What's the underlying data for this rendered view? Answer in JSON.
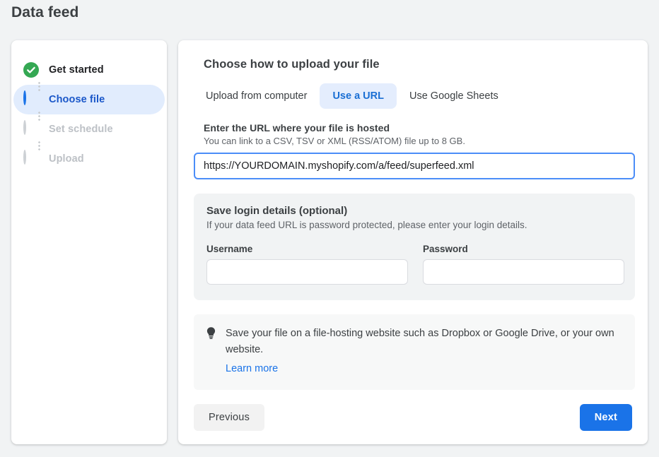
{
  "page": {
    "title": "Data feed",
    "background_color": "#f1f3f4"
  },
  "stepper": {
    "steps": [
      {
        "label": "Get started",
        "state": "done",
        "icon": "check-circle-icon"
      },
      {
        "label": "Choose file",
        "state": "active",
        "icon": "half-circle-icon"
      },
      {
        "label": "Set schedule",
        "state": "todo",
        "icon": "empty-circle-icon"
      },
      {
        "label": "Upload",
        "state": "todo",
        "icon": "empty-circle-icon"
      }
    ],
    "colors": {
      "done": "#34a853",
      "active": "#1a73e8",
      "active_row_background": "#e1ecfd",
      "todo": "#cdd1d5"
    }
  },
  "main": {
    "heading": "Choose how to upload your file",
    "tabs": [
      {
        "label": "Upload from computer",
        "active": false
      },
      {
        "label": "Use a URL",
        "active": true
      },
      {
        "label": "Use Google Sheets",
        "active": false
      }
    ],
    "url_section": {
      "label": "Enter the URL where your file is hosted",
      "hint": "You can link to a CSV, TSV or XML (RSS/ATOM) file up to 8 GB.",
      "value": "https://YOURDOMAIN.myshopify.com/a/feed/superfeed.xml",
      "placeholder": "",
      "focused": true,
      "focus_border_color": "#4b8df8"
    },
    "login_panel": {
      "title": "Save login details (optional)",
      "subtitle": "If your data feed URL is password protected, please enter your login details.",
      "username_label": "Username",
      "username_value": "",
      "username_placeholder": "",
      "password_label": "Password",
      "password_value": "",
      "password_placeholder": ""
    },
    "tip_panel": {
      "icon": "lightbulb-icon",
      "text": "Save your file on a file-hosting website such as Dropbox or Google Drive, or your own website.",
      "link_label": "Learn more",
      "link_color": "#1a73e8"
    },
    "footer": {
      "previous_label": "Previous",
      "next_label": "Next",
      "next_color": "#1a73e8"
    }
  }
}
